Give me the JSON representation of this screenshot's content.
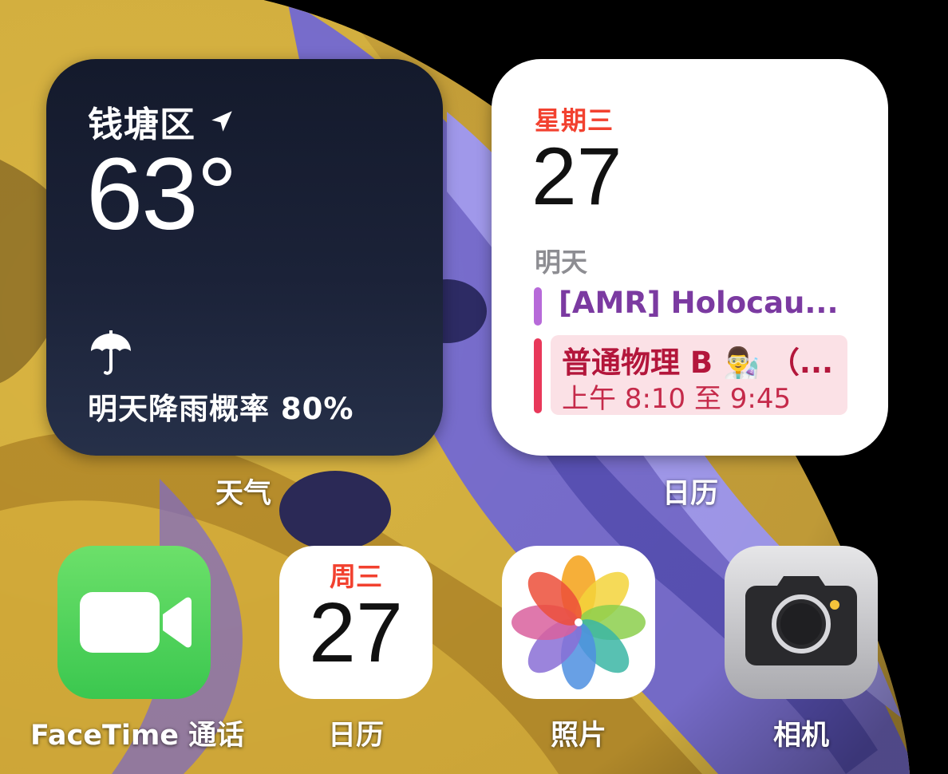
{
  "colors": {
    "calendar_red": "#f2412f",
    "event_purple": "#b76ad9",
    "event_red": "#e8385a",
    "weather_bg": "#1b2238"
  },
  "weather_widget": {
    "location": "钱塘区",
    "temperature": "63°",
    "forecast": "明天降雨概率 80%",
    "label": "天气",
    "icons": [
      "location-arrow-icon",
      "umbrella-icon"
    ]
  },
  "calendar_widget": {
    "weekday": "星期三",
    "day": "27",
    "section": "明天",
    "events": [
      {
        "title": "[AMR] Holocau..."
      },
      {
        "title": "普通物理 B 👨‍🔬 （...",
        "time": "上午 8:10 至 9:45"
      }
    ],
    "label": "日历"
  },
  "apps": [
    {
      "label": "FaceTime 通话",
      "icon": "facetime-video-icon"
    },
    {
      "label": "日历",
      "icon": "calendar-icon",
      "weekday": "周三",
      "day": "27"
    },
    {
      "label": "照片",
      "icon": "photos-flower-icon"
    },
    {
      "label": "相机",
      "icon": "camera-icon"
    }
  ]
}
